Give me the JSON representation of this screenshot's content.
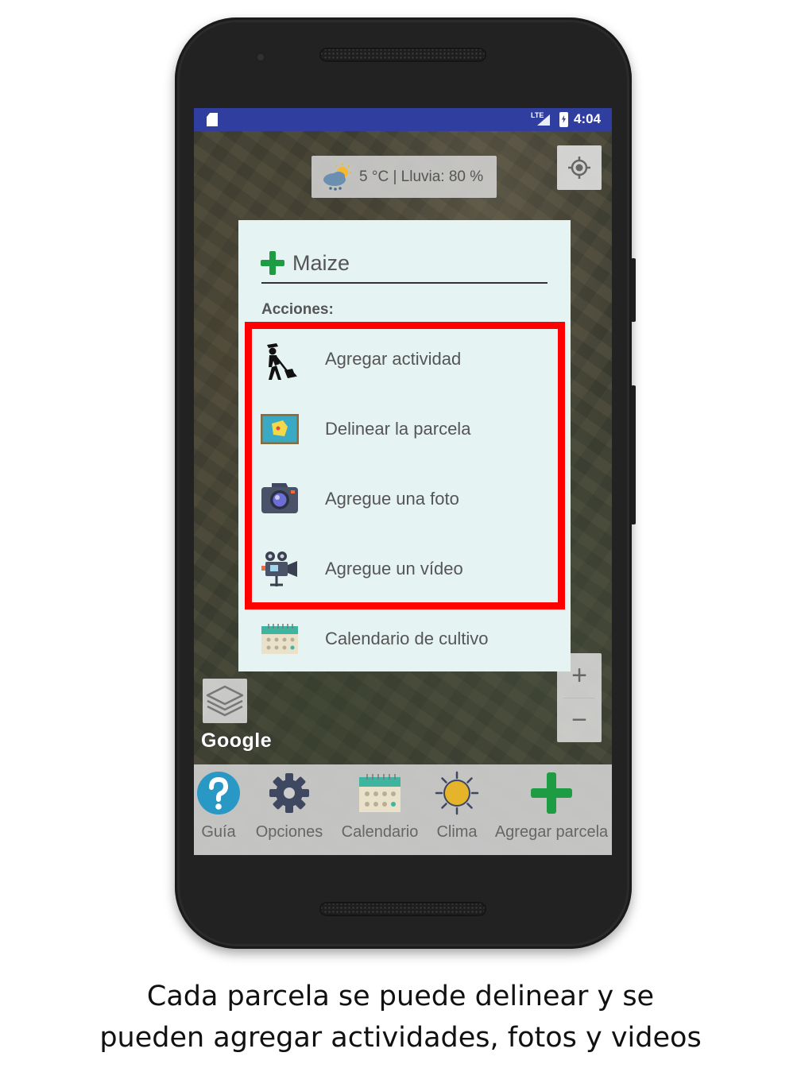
{
  "status_bar": {
    "network": "LTE",
    "time": "4:04"
  },
  "map": {
    "weather": "5 °C | Lluvia: 80 %",
    "zoom_in_label": "+",
    "zoom_out_label": "−",
    "attribution": "Google"
  },
  "dialog": {
    "title": "Maize",
    "section_label": "Acciones:",
    "actions": [
      {
        "label": "Agregar actividad",
        "icon": "farmer-digging-icon"
      },
      {
        "label": "Delinear la parcela",
        "icon": "map-outline-icon"
      },
      {
        "label": "Agregue una foto",
        "icon": "camera-icon"
      },
      {
        "label": "Agregue un vídeo",
        "icon": "video-camera-icon"
      },
      {
        "label": "Calendario de cultivo",
        "icon": "calendar-icon"
      }
    ]
  },
  "bottom_nav": {
    "items": [
      {
        "label": "Guía",
        "icon": "help-icon"
      },
      {
        "label": "Opciones",
        "icon": "gear-icon"
      },
      {
        "label": "Calendario",
        "icon": "calendar-icon"
      },
      {
        "label": "Clima",
        "icon": "sun-icon"
      },
      {
        "label": "Agregar parcela",
        "icon": "plus-icon"
      }
    ]
  },
  "colors": {
    "status_bar": "#303f9f",
    "dialog_background": "#e5f3f2",
    "highlight": "#ff0000",
    "accent_green": "#1e9c44"
  },
  "caption": {
    "line1": "Cada parcela se puede delinear y se",
    "line2": "pueden agregar actividades, fotos y videos"
  }
}
